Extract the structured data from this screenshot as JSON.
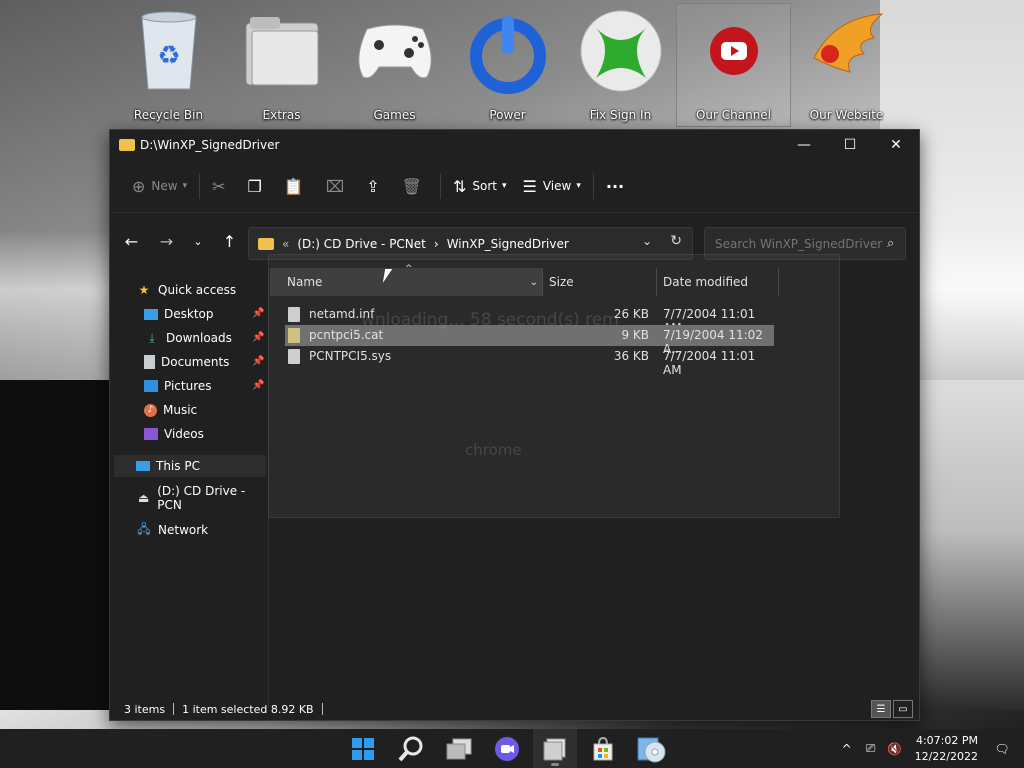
{
  "desktop": {
    "icons": [
      {
        "label": "Recycle Bin"
      },
      {
        "label": "Extras"
      },
      {
        "label": "Games"
      },
      {
        "label": "Power"
      },
      {
        "label": "Fix Sign In"
      },
      {
        "label": "Our Channel"
      },
      {
        "label": "Our Website"
      }
    ]
  },
  "window": {
    "title": "D:\\WinXP_SignedDriver",
    "controls": {
      "minimize": "—",
      "maximize": "☐",
      "close": "✕"
    }
  },
  "commandbar": {
    "new_label": "New",
    "sort_label": "Sort",
    "view_label": "View",
    "more_label": "···"
  },
  "address": {
    "prefix": "«",
    "crumbs": [
      "(D:) CD Drive - PCNet",
      "WinXP_SignedDriver"
    ],
    "separator": "›"
  },
  "search": {
    "placeholder": "Search WinXP_SignedDriver"
  },
  "sidebar": {
    "quick_access": "Quick access",
    "items": [
      {
        "label": "Desktop"
      },
      {
        "label": "Downloads"
      },
      {
        "label": "Documents"
      },
      {
        "label": "Pictures"
      },
      {
        "label": "Music"
      },
      {
        "label": "Videos"
      }
    ],
    "this_pc": "This PC",
    "drive": "(D:) CD Drive - PCN",
    "network": "Network"
  },
  "columns": {
    "name": "Name",
    "size": "Size",
    "date": "Date modified"
  },
  "files": [
    {
      "name": "netamd.inf",
      "size": "26 KB",
      "date": "7/7/2004 11:01 AM"
    },
    {
      "name": "pcntpci5.cat",
      "size": "9 KB",
      "date": "7/19/2004 11:02 A..."
    },
    {
      "name": "PCNTPCI5.sys",
      "size": "36 KB",
      "date": "7/7/2004 11:01 AM"
    }
  ],
  "status": {
    "count": "3 items",
    "selected": "1 item selected  8.92 KB"
  },
  "overlay": {
    "text": "wnloading... 58 second(s) rem",
    "brand": "chrome"
  },
  "taskbar": {
    "time": "4:07:02 PM",
    "date": "12/22/2022"
  },
  "colors": {
    "accent_folder": "#f0c24b",
    "window_bg": "#202020",
    "selection": "#767676"
  }
}
